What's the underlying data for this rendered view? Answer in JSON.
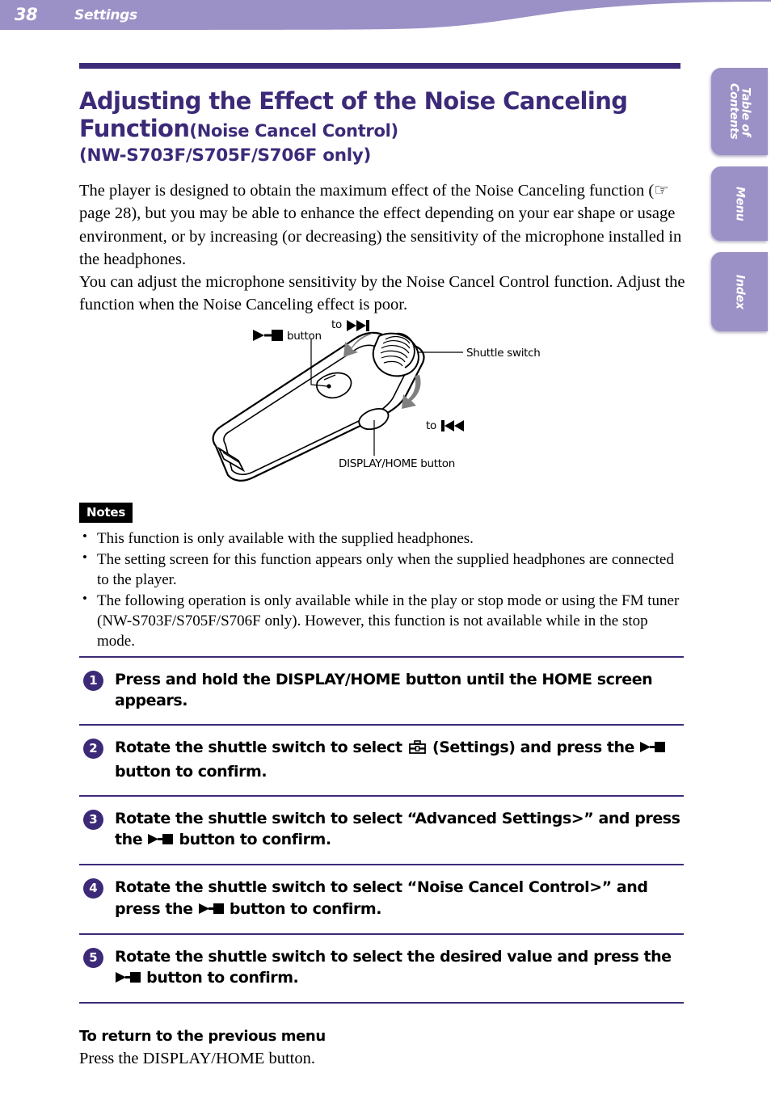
{
  "header": {
    "page_number": "38",
    "section_title": "Settings",
    "bar_color": "#9c91c6",
    "text_color": "#ffffff"
  },
  "side_tabs": [
    {
      "label": "Table of\nContents",
      "name": "table-of-contents"
    },
    {
      "label": "Menu",
      "name": "menu"
    },
    {
      "label": "Index",
      "name": "index"
    }
  ],
  "accent_color": "#3c2a78",
  "title": {
    "main": "Adjusting the Effect of the Noise Canceling Function",
    "line1": "Adjusting the Effect of the Noise Canceling",
    "line2_main": "Function",
    "line2_sub": "(Noise Cancel Control)",
    "line3_model": "(NW-S703F/S705F/S706F only)"
  },
  "intro": {
    "paragraph1": "The player is designed to obtain the maximum effect of the Noise Canceling function (☞ page 28), but you may be able to enhance the effect depending on your ear shape or usage environment, or by increasing (or decreasing) the sensitivity of the microphone installed in the headphones.",
    "paragraph2": "You can adjust the microphone sensitivity by the Noise Cancel Control function. Adjust the function when the Noise Canceling effect is poor."
  },
  "figure": {
    "caption_play_stop_button": "button",
    "label_to_forward": "to",
    "label_to_rewind": "to",
    "label_shuttle_switch": "Shuttle switch",
    "label_display_home_button": "DISPLAY/HOME button"
  },
  "notes": {
    "badge": "Notes",
    "items": [
      "This function is only available with the supplied headphones.",
      "The setting screen for this function appears only when the supplied headphones are connected to the player.",
      "The following operation is only available while in the play or stop mode or using the FM tuner (NW-S703F/S705F/S706F only). However, this function is not available while in the stop mode."
    ]
  },
  "steps": [
    {
      "number": "1",
      "text_before": "Press and hold the DISPLAY/HOME button until the HOME screen appears.",
      "text_after": "",
      "has_settings_icon": false,
      "has_play_glyph": false
    },
    {
      "number": "2",
      "text_before": "Rotate the shuttle switch to select",
      "text_mid": "(Settings) and press the",
      "text_after": "button to confirm.",
      "has_settings_icon": true,
      "has_play_glyph": true
    },
    {
      "number": "3",
      "text_before": "Rotate the shuttle switch to select “Advanced Settings>” and press the",
      "text_after": "button to confirm.",
      "has_settings_icon": false,
      "has_play_glyph": true
    },
    {
      "number": "4",
      "text_before": "Rotate the shuttle switch to select “Noise Cancel Control>” and press the",
      "text_after": "button to confirm.",
      "has_settings_icon": false,
      "has_play_glyph": true
    },
    {
      "number": "5",
      "text_before": "Rotate the shuttle switch to select the desired value and press the",
      "text_after": "button to confirm.",
      "has_settings_icon": false,
      "has_play_glyph": true
    }
  ],
  "return_section": {
    "heading": "To return to the previous menu",
    "body": "Press the DISPLAY/HOME button."
  }
}
